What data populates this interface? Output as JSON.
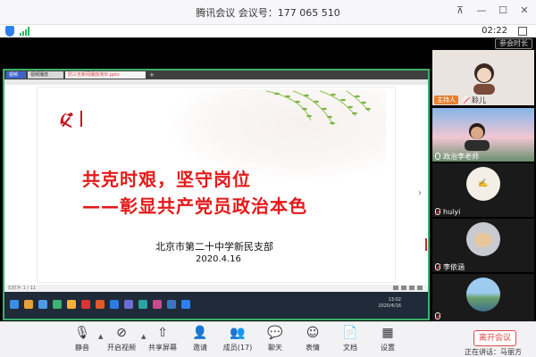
{
  "app": {
    "title": "腾讯会议 会议号：177 065 510",
    "timer": "02:22",
    "duration_button": "参会时长"
  },
  "shared_window": {
    "tabs": [
      "视频",
      "视频播放",
      "防三无新闻播放演示.pptx"
    ],
    "page_indicator": "幻灯片 1 / 11",
    "tray_time": "13:02",
    "tray_date": "2020/4/16"
  },
  "slide": {
    "title_line1": "共克时艰，坚守岗位",
    "title_line2": "——彰显共产党员政治本色",
    "organization": "北京市第二十中学新民支部",
    "date": "2020.4.16",
    "accent_color": "#e31a1a"
  },
  "participants": [
    {
      "name": "",
      "role": "",
      "tile": "blank"
    },
    {
      "name": "聆儿",
      "role": "主持人",
      "tile": "avatar-girl"
    },
    {
      "name": "政治李老师",
      "role": "",
      "tile": "camera"
    },
    {
      "name": "huiyi",
      "role": "",
      "tile": "calligraphy"
    },
    {
      "name": "李依涵",
      "role": "",
      "tile": "cat"
    },
    {
      "name": "",
      "role": "",
      "tile": "landscape"
    }
  ],
  "toolbar": {
    "mute": "静音",
    "video": "开启视频",
    "share": "共享屏幕",
    "invite": "邀请",
    "members": "成员(17)",
    "chat": "聊天",
    "reactions": "表情",
    "docs": "文档",
    "settings": "设置",
    "end": "离开会议"
  },
  "status": {
    "speaking": "正在讲话：马丽方"
  }
}
